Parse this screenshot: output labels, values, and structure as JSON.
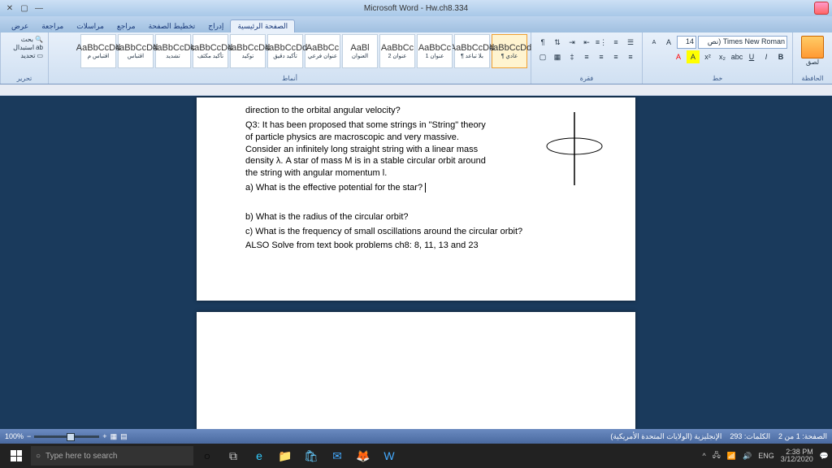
{
  "window": {
    "title": "Microsoft Word - Hw.ch8.334"
  },
  "tabs": {
    "home": "الصفحة الرئيسية",
    "insert": "إدراج",
    "layout": "تخطيط الصفحة",
    "refs": "مراجع",
    "mail": "مراسلات",
    "review": "مراجعة",
    "view": "عرض"
  },
  "ribbon": {
    "clipboard_label": "الحافظة",
    "paste": "لصق",
    "font_label": "خط",
    "font_name": "Times New Roman (نص",
    "font_size": "14",
    "para_label": "فقرة",
    "styles_label": "أنماط",
    "edit_label": "تحرير",
    "find": "بحث",
    "replace": "استبدال",
    "select": "تحديد"
  },
  "styles": [
    {
      "preview": "AaBbCcDd",
      "name": "عادي ¶",
      "sel": true
    },
    {
      "preview": "AaBbCcDd",
      "name": "بلا تباعد ¶"
    },
    {
      "preview": "AaBbCc",
      "name": "عنوان 1"
    },
    {
      "preview": "AaBbCc",
      "name": "عنوان 2"
    },
    {
      "preview": "AaBl",
      "name": "العنوان"
    },
    {
      "preview": "AaBbCc",
      "name": "عنوان فرعي"
    },
    {
      "preview": "AaBbCcDd",
      "name": "تأكيد دقيق"
    },
    {
      "preview": "AaBbCcDd",
      "name": "توكيد"
    },
    {
      "preview": "AaBbCcDd",
      "name": "تأكيد مكثف"
    },
    {
      "preview": "AaBbCcDc",
      "name": "تشديد"
    },
    {
      "preview": "AaBbCcDd",
      "name": "اقتباس"
    },
    {
      "preview": "AaBbCcDd",
      "name": "اقتباس م"
    }
  ],
  "doc": {
    "line0": "direction to the orbital angular velocity?",
    "q3a": "Q3: It has been proposed that some strings in \"String\" theory of particle physics are macroscopic and very massive. Consider an infinitely long straight string with a linear mass density λ. A star of mass M is in a stable circular orbit around the string with angular momentum l.",
    "qa": "a) What is the effective potential for the star?",
    "qb": "b) What is the radius of the circular orbit?",
    "qc": "c) What is the frequency of small oscillations around the circular orbit?",
    "also": " ALSO Solve from text book problems ch8: 8, 11, 13 and 23"
  },
  "status": {
    "page": "الصفحة: 1 من 2",
    "words": "الكلمات: 293",
    "lang": "الإنجليزية (الولايات المتحدة الأمريكية)",
    "zoom": "100%"
  },
  "taskbar": {
    "search": "Type here to search",
    "time": "2:38 PM",
    "date": "3/12/2020",
    "lang": "ENG"
  }
}
